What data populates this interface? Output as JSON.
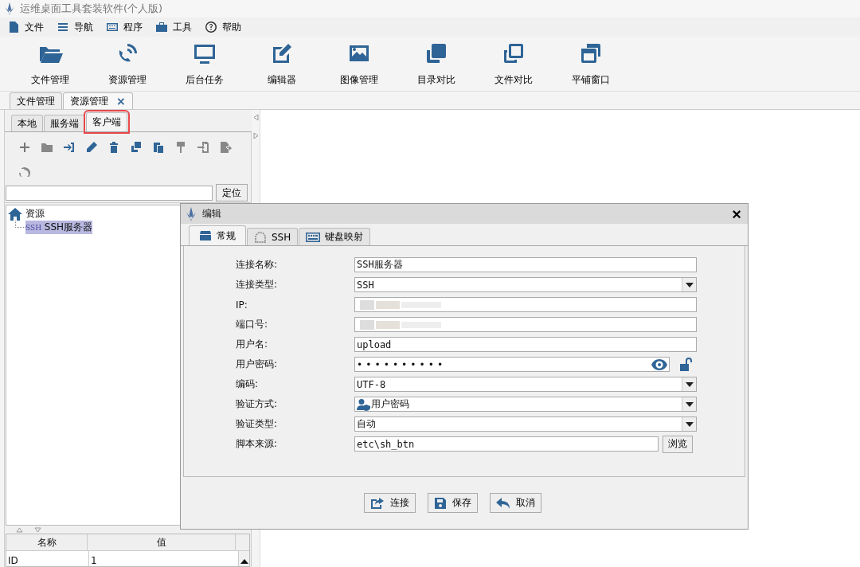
{
  "window": {
    "title": "运维桌面工具套装软件(个人版)"
  },
  "menu": [
    "文件",
    "导航",
    "程序",
    "工具",
    "帮助"
  ],
  "toolbar": [
    "文件管理",
    "资源管理",
    "后台任务",
    "编辑器",
    "图像管理",
    "目录对比",
    "文件对比",
    "平铺窗口"
  ],
  "doc_tabs": [
    {
      "label": "文件管理",
      "selected": false,
      "closable": false
    },
    {
      "label": "资源管理",
      "selected": true,
      "closable": true
    }
  ],
  "close_glyph": "×",
  "panel_tabs": [
    {
      "label": "本地",
      "selected": false,
      "highlighted": false
    },
    {
      "label": "服务端",
      "selected": false,
      "highlighted": false
    },
    {
      "label": "客户端",
      "selected": true,
      "highlighted": true
    }
  ],
  "locate_button": "定位",
  "tree": {
    "label": "资源",
    "children": [
      {
        "label": "SSH服务器",
        "tag": "SSH",
        "selected": true
      }
    ]
  },
  "table": {
    "columns": [
      "名称",
      "值"
    ],
    "rows": [
      [
        "ID",
        "1"
      ]
    ]
  },
  "dialog": {
    "title": "编辑",
    "close": "×",
    "tabs": [
      {
        "label": "常规",
        "selected": true
      },
      {
        "label": "SSH",
        "selected": false
      },
      {
        "label": "键盘映射",
        "selected": false
      }
    ],
    "fields": [
      {
        "label": "连接名称:",
        "kind": "text",
        "value": "SSH服务器"
      },
      {
        "label": "连接类型:",
        "kind": "select",
        "value": "SSH"
      },
      {
        "label": "IP:",
        "kind": "blurred"
      },
      {
        "label": "端口号:",
        "kind": "blurred"
      },
      {
        "label": "用户名:",
        "kind": "text",
        "value": "upload"
      },
      {
        "label": "用户密码:",
        "kind": "password",
        "value": "••••••••••"
      },
      {
        "label": "编码:",
        "kind": "select",
        "value": "UTF-8"
      },
      {
        "label": "验证方式:",
        "kind": "select",
        "value": "用户密码",
        "icon": true
      },
      {
        "label": "验证类型:",
        "kind": "select",
        "value": "自动"
      },
      {
        "label": "脚本来源:",
        "kind": "browse",
        "value": "etc\\sh_btn",
        "button": "浏览"
      }
    ],
    "buttons": [
      "连接",
      "保存",
      "取消"
    ]
  }
}
